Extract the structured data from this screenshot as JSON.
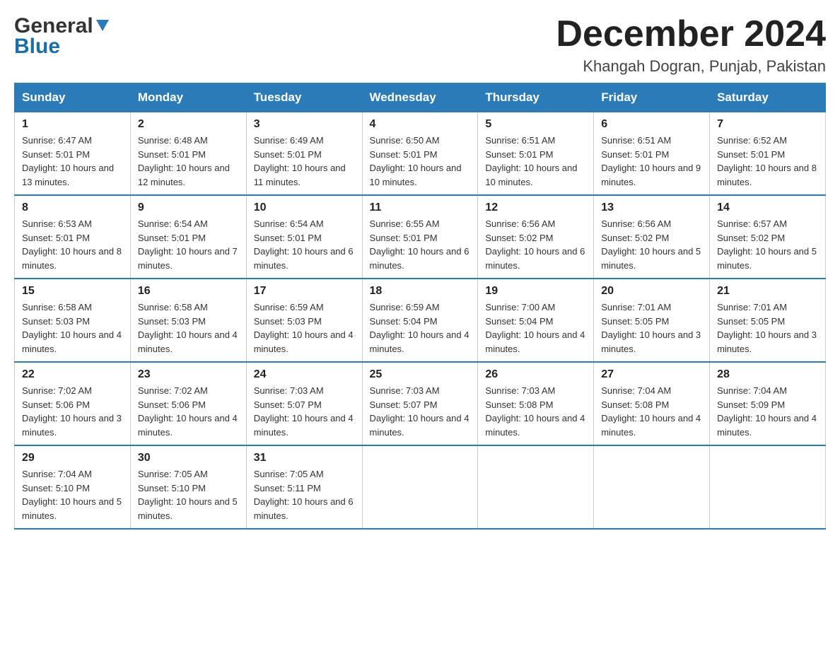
{
  "header": {
    "logo_general": "General",
    "logo_blue": "Blue",
    "month_title": "December 2024",
    "location": "Khangah Dogran, Punjab, Pakistan"
  },
  "days_of_week": [
    "Sunday",
    "Monday",
    "Tuesday",
    "Wednesday",
    "Thursday",
    "Friday",
    "Saturday"
  ],
  "weeks": [
    [
      {
        "day": "1",
        "sunrise": "6:47 AM",
        "sunset": "5:01 PM",
        "daylight": "10 hours and 13 minutes."
      },
      {
        "day": "2",
        "sunrise": "6:48 AM",
        "sunset": "5:01 PM",
        "daylight": "10 hours and 12 minutes."
      },
      {
        "day": "3",
        "sunrise": "6:49 AM",
        "sunset": "5:01 PM",
        "daylight": "10 hours and 11 minutes."
      },
      {
        "day": "4",
        "sunrise": "6:50 AM",
        "sunset": "5:01 PM",
        "daylight": "10 hours and 10 minutes."
      },
      {
        "day": "5",
        "sunrise": "6:51 AM",
        "sunset": "5:01 PM",
        "daylight": "10 hours and 10 minutes."
      },
      {
        "day": "6",
        "sunrise": "6:51 AM",
        "sunset": "5:01 PM",
        "daylight": "10 hours and 9 minutes."
      },
      {
        "day": "7",
        "sunrise": "6:52 AM",
        "sunset": "5:01 PM",
        "daylight": "10 hours and 8 minutes."
      }
    ],
    [
      {
        "day": "8",
        "sunrise": "6:53 AM",
        "sunset": "5:01 PM",
        "daylight": "10 hours and 8 minutes."
      },
      {
        "day": "9",
        "sunrise": "6:54 AM",
        "sunset": "5:01 PM",
        "daylight": "10 hours and 7 minutes."
      },
      {
        "day": "10",
        "sunrise": "6:54 AM",
        "sunset": "5:01 PM",
        "daylight": "10 hours and 6 minutes."
      },
      {
        "day": "11",
        "sunrise": "6:55 AM",
        "sunset": "5:01 PM",
        "daylight": "10 hours and 6 minutes."
      },
      {
        "day": "12",
        "sunrise": "6:56 AM",
        "sunset": "5:02 PM",
        "daylight": "10 hours and 6 minutes."
      },
      {
        "day": "13",
        "sunrise": "6:56 AM",
        "sunset": "5:02 PM",
        "daylight": "10 hours and 5 minutes."
      },
      {
        "day": "14",
        "sunrise": "6:57 AM",
        "sunset": "5:02 PM",
        "daylight": "10 hours and 5 minutes."
      }
    ],
    [
      {
        "day": "15",
        "sunrise": "6:58 AM",
        "sunset": "5:03 PM",
        "daylight": "10 hours and 4 minutes."
      },
      {
        "day": "16",
        "sunrise": "6:58 AM",
        "sunset": "5:03 PM",
        "daylight": "10 hours and 4 minutes."
      },
      {
        "day": "17",
        "sunrise": "6:59 AM",
        "sunset": "5:03 PM",
        "daylight": "10 hours and 4 minutes."
      },
      {
        "day": "18",
        "sunrise": "6:59 AM",
        "sunset": "5:04 PM",
        "daylight": "10 hours and 4 minutes."
      },
      {
        "day": "19",
        "sunrise": "7:00 AM",
        "sunset": "5:04 PM",
        "daylight": "10 hours and 4 minutes."
      },
      {
        "day": "20",
        "sunrise": "7:01 AM",
        "sunset": "5:05 PM",
        "daylight": "10 hours and 3 minutes."
      },
      {
        "day": "21",
        "sunrise": "7:01 AM",
        "sunset": "5:05 PM",
        "daylight": "10 hours and 3 minutes."
      }
    ],
    [
      {
        "day": "22",
        "sunrise": "7:02 AM",
        "sunset": "5:06 PM",
        "daylight": "10 hours and 3 minutes."
      },
      {
        "day": "23",
        "sunrise": "7:02 AM",
        "sunset": "5:06 PM",
        "daylight": "10 hours and 4 minutes."
      },
      {
        "day": "24",
        "sunrise": "7:03 AM",
        "sunset": "5:07 PM",
        "daylight": "10 hours and 4 minutes."
      },
      {
        "day": "25",
        "sunrise": "7:03 AM",
        "sunset": "5:07 PM",
        "daylight": "10 hours and 4 minutes."
      },
      {
        "day": "26",
        "sunrise": "7:03 AM",
        "sunset": "5:08 PM",
        "daylight": "10 hours and 4 minutes."
      },
      {
        "day": "27",
        "sunrise": "7:04 AM",
        "sunset": "5:08 PM",
        "daylight": "10 hours and 4 minutes."
      },
      {
        "day": "28",
        "sunrise": "7:04 AM",
        "sunset": "5:09 PM",
        "daylight": "10 hours and 4 minutes."
      }
    ],
    [
      {
        "day": "29",
        "sunrise": "7:04 AM",
        "sunset": "5:10 PM",
        "daylight": "10 hours and 5 minutes."
      },
      {
        "day": "30",
        "sunrise": "7:05 AM",
        "sunset": "5:10 PM",
        "daylight": "10 hours and 5 minutes."
      },
      {
        "day": "31",
        "sunrise": "7:05 AM",
        "sunset": "5:11 PM",
        "daylight": "10 hours and 6 minutes."
      },
      null,
      null,
      null,
      null
    ]
  ]
}
